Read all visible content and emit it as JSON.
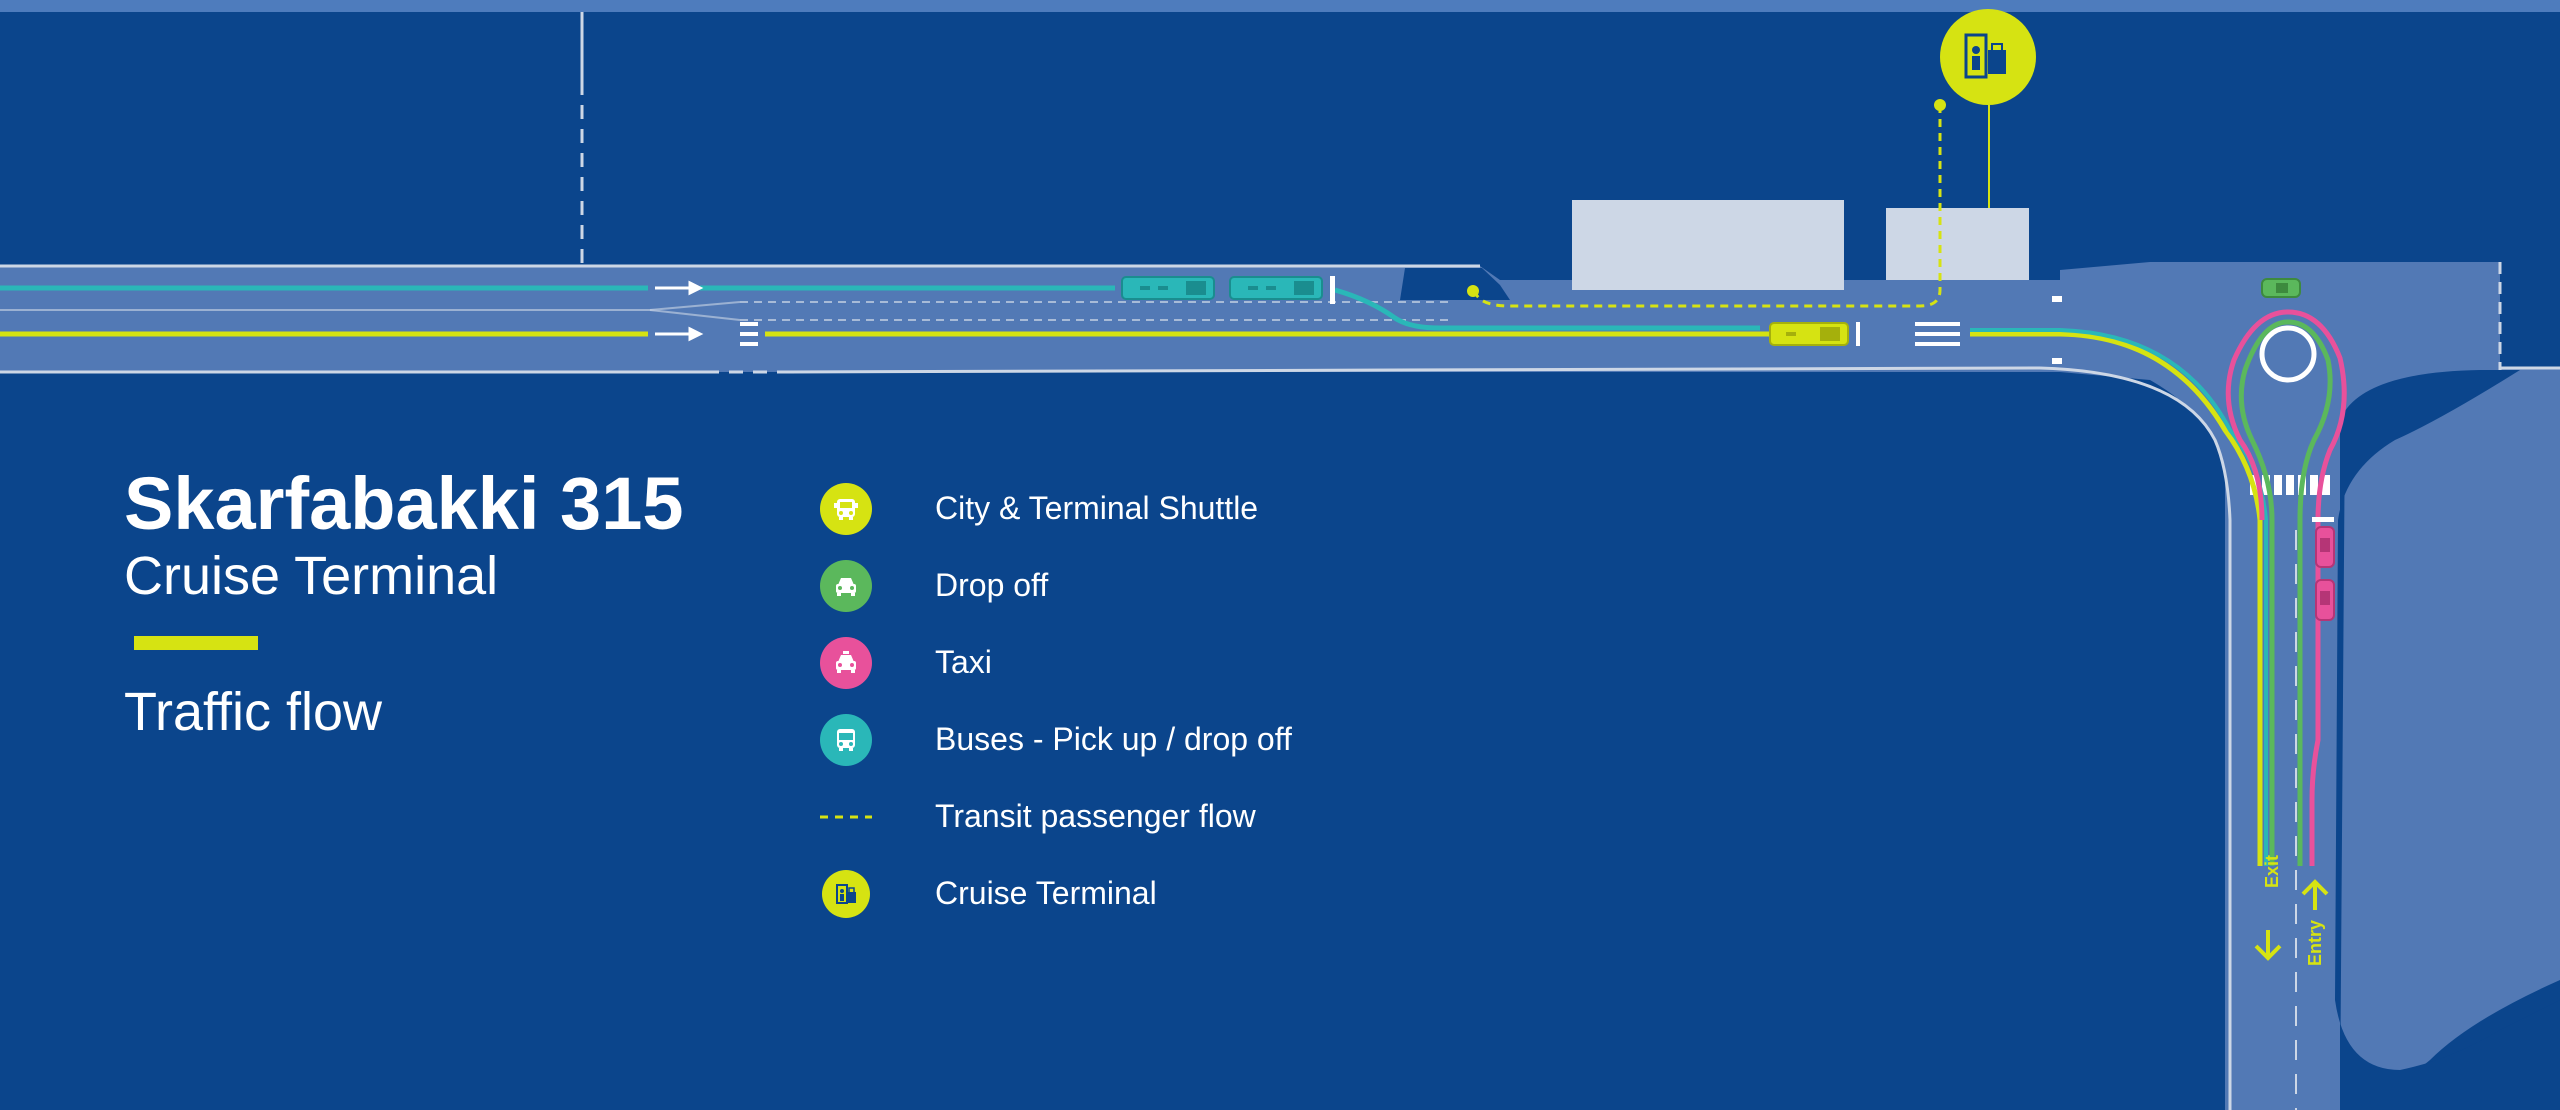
{
  "title": "Skarfabakki 315",
  "subtitle": "Cruise Terminal",
  "section_title": "Traffic flow",
  "legend": [
    {
      "label": "City & Terminal Shuttle",
      "icon": "shuttle-bus-icon",
      "color": "#d6e312"
    },
    {
      "label": "Drop off",
      "icon": "car-icon",
      "color": "#5bb85c"
    },
    {
      "label": "Taxi",
      "icon": "taxi-icon",
      "color": "#e8519b"
    },
    {
      "label": "Buses - Pick up / drop off",
      "icon": "bus-icon",
      "color": "#2ab7b8"
    },
    {
      "label": "Transit passenger flow",
      "icon": "dashed-line-icon",
      "color": "#d6e312"
    },
    {
      "label": "Cruise Terminal",
      "icon": "terminal-building-icon",
      "color": "#d6e312"
    }
  ],
  "road_labels": {
    "exit": "Exit",
    "entry": "Entry"
  },
  "colors": {
    "background": "#0b458c",
    "road": "#5279b5",
    "building": "#cdd7e6",
    "shuttle": "#d6e312",
    "drop_off": "#5bb85c",
    "taxi": "#e8519b",
    "bus": "#2ab7b8",
    "top_strip": "#4e7cbd"
  }
}
